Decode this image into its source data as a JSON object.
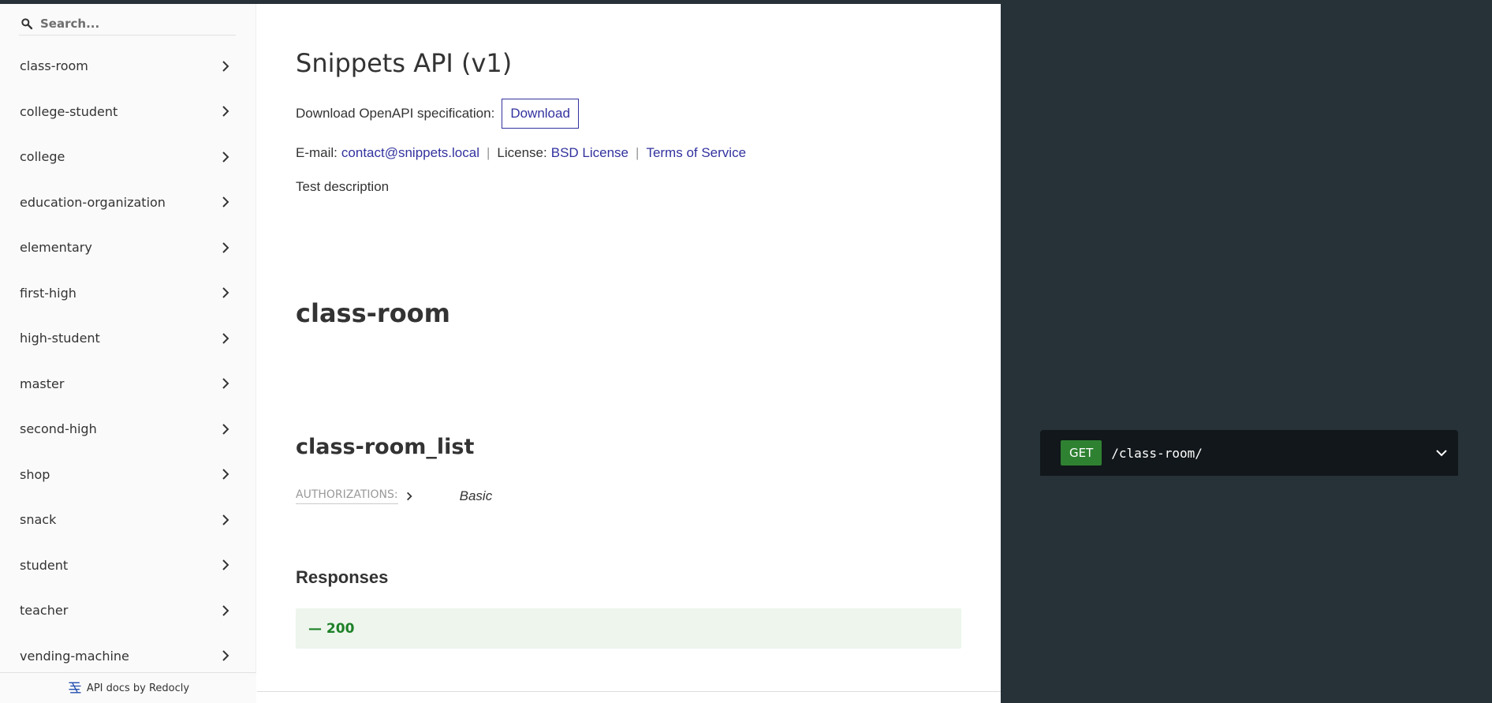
{
  "search": {
    "placeholder": "Search..."
  },
  "sidebar": {
    "items": [
      {
        "label": "class-room"
      },
      {
        "label": "college-student"
      },
      {
        "label": "college"
      },
      {
        "label": "education-organization"
      },
      {
        "label": "elementary"
      },
      {
        "label": "first-high"
      },
      {
        "label": "high-student"
      },
      {
        "label": "master"
      },
      {
        "label": "second-high"
      },
      {
        "label": "shop"
      },
      {
        "label": "snack"
      },
      {
        "label": "student"
      },
      {
        "label": "teacher"
      },
      {
        "label": "vending-machine"
      }
    ],
    "footer": "API docs by Redocly"
  },
  "main": {
    "title": "Snippets API (v1)",
    "download_label": "Download OpenAPI specification:",
    "download_button": "Download",
    "email_label": "E-mail:",
    "email": "contact@snippets.local",
    "license_label": "License:",
    "license": "BSD License",
    "terms": "Terms of Service",
    "description": "Test description",
    "section": "class-room",
    "operation": "class-room_list",
    "auth_label": "AUTHORIZATIONS:",
    "auth_value": "Basic",
    "responses_label": "Responses",
    "response_200": "— 200"
  },
  "right": {
    "method": "GET",
    "path": "/class-room/"
  },
  "colors": {
    "accent": "#32329f",
    "right_panel": "#263238",
    "get_method": "#2f8132",
    "success_text": "#1d8127",
    "success_bg": "#edf5ed"
  }
}
